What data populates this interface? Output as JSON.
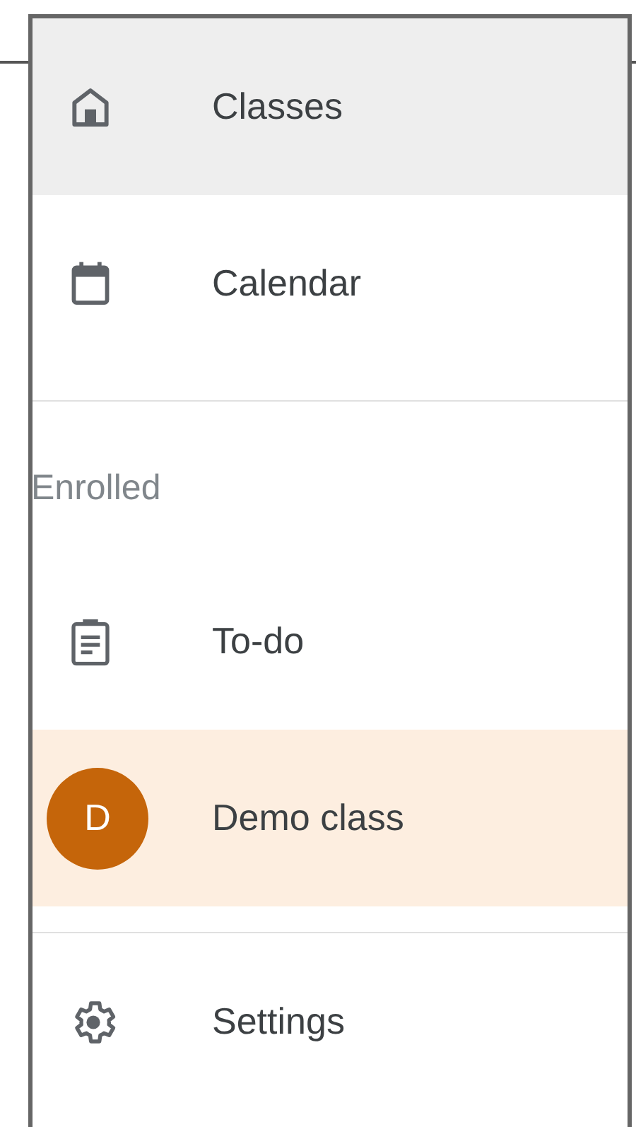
{
  "sections": [
    {
      "items": [
        {
          "kind": "home",
          "label": "Classes",
          "selected": true
        },
        {
          "kind": "calendar",
          "label": "Calendar",
          "selected": false
        }
      ]
    },
    {
      "heading": "Enrolled",
      "items": [
        {
          "kind": "todo",
          "label": "To-do",
          "selected": false
        },
        {
          "kind": "class",
          "avatar": "D",
          "label": "Demo class",
          "color": "#c5650a",
          "selected": true
        }
      ]
    },
    {
      "items": [
        {
          "kind": "settings",
          "label": "Settings",
          "selected": false
        }
      ]
    }
  ]
}
